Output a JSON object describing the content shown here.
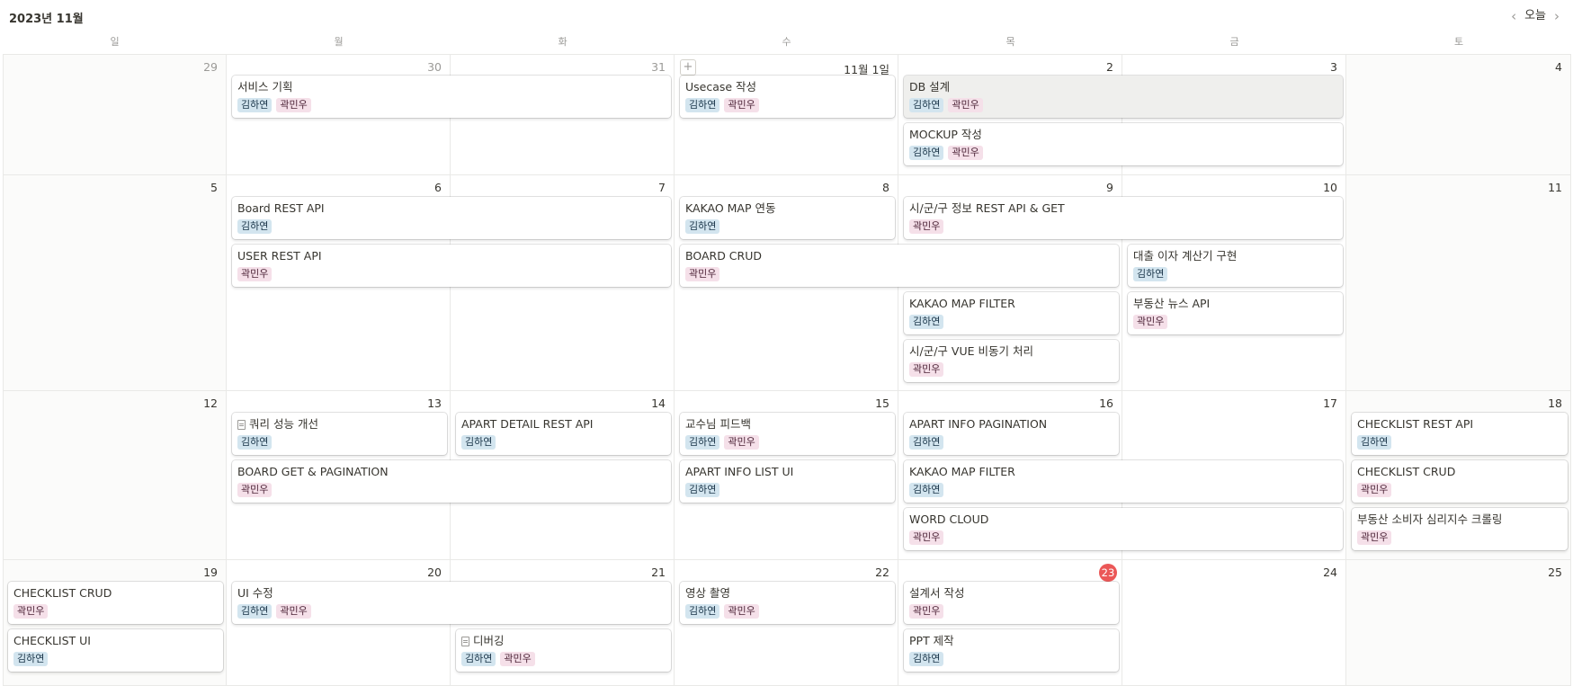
{
  "header": {
    "title": "2023년 11월",
    "today_label": "오늘",
    "prev_icon": "chevron-left-icon",
    "next_icon": "chevron-right-icon"
  },
  "weekdays": [
    "일",
    "월",
    "화",
    "수",
    "목",
    "금",
    "토"
  ],
  "today_date": "23",
  "add_button_icon": "plus-icon",
  "colors": {
    "tag_blue": "#d3e5ef",
    "tag_pink": "#f5e0e9",
    "today": "#eb5757"
  },
  "tag_names": {
    "kim": "김하연",
    "kwak": "곽민우"
  },
  "weeks": [
    {
      "days": [
        {
          "label": "29",
          "muted": true
        },
        {
          "label": "30",
          "muted": true
        },
        {
          "label": "31",
          "muted": true
        },
        {
          "label": "11월 1일",
          "plus": true
        },
        {
          "label": "2"
        },
        {
          "label": "3"
        },
        {
          "label": "4"
        }
      ],
      "events": [
        {
          "title": "서비스 기획",
          "col": 1,
          "span": 2,
          "lane": 0,
          "tags": [
            "kim",
            "kwak"
          ]
        },
        {
          "title": "Usecase 작성",
          "col": 3,
          "span": 1,
          "lane": 0,
          "tags": [
            "kim",
            "kwak"
          ]
        },
        {
          "title": "DB 설계",
          "col": 4,
          "span": 2,
          "lane": 0,
          "tags": [
            "kim",
            "kwak"
          ],
          "selected": true
        },
        {
          "title": "MOCKUP 작성",
          "col": 4,
          "span": 2,
          "lane": 1,
          "tags": [
            "kim",
            "kwak"
          ]
        }
      ]
    },
    {
      "days": [
        {
          "label": "5"
        },
        {
          "label": "6"
        },
        {
          "label": "7"
        },
        {
          "label": "8"
        },
        {
          "label": "9"
        },
        {
          "label": "10"
        },
        {
          "label": "11"
        }
      ],
      "events": [
        {
          "title": "Board REST API",
          "col": 1,
          "span": 2,
          "lane": 0,
          "tags": [
            "kim"
          ]
        },
        {
          "title": "KAKAO MAP 연동",
          "col": 3,
          "span": 1,
          "lane": 0,
          "tags": [
            "kim"
          ]
        },
        {
          "title": "시/군/구 정보 REST API & GET",
          "col": 4,
          "span": 2,
          "lane": 0,
          "tags": [
            "kwak"
          ]
        },
        {
          "title": "USER REST API",
          "col": 1,
          "span": 2,
          "lane": 1,
          "tags": [
            "kwak"
          ]
        },
        {
          "title": "BOARD CRUD",
          "col": 3,
          "span": 2,
          "lane": 1,
          "tags": [
            "kwak"
          ]
        },
        {
          "title": "대출 이자 계산기 구현",
          "col": 5,
          "span": 1,
          "lane": 1,
          "tags": [
            "kim"
          ]
        },
        {
          "title": "KAKAO MAP FILTER",
          "col": 4,
          "span": 1,
          "lane": 2,
          "tags": [
            "kim"
          ]
        },
        {
          "title": "부동산 뉴스 API",
          "col": 5,
          "span": 1,
          "lane": 2,
          "tags": [
            "kwak"
          ]
        },
        {
          "title": "시/군/구 VUE 비동기 처리",
          "col": 4,
          "span": 1,
          "lane": 3,
          "tags": [
            "kwak"
          ]
        }
      ]
    },
    {
      "days": [
        {
          "label": "12"
        },
        {
          "label": "13"
        },
        {
          "label": "14"
        },
        {
          "label": "15"
        },
        {
          "label": "16"
        },
        {
          "label": "17"
        },
        {
          "label": "18"
        }
      ],
      "events": [
        {
          "title": "쿼리 성능 개선",
          "col": 1,
          "span": 1,
          "lane": 0,
          "tags": [
            "kim"
          ],
          "doc": true
        },
        {
          "title": "APART DETAIL REST API",
          "col": 2,
          "span": 1,
          "lane": 0,
          "tags": [
            "kim"
          ]
        },
        {
          "title": "교수님 피드백",
          "col": 3,
          "span": 1,
          "lane": 0,
          "tags": [
            "kim",
            "kwak"
          ]
        },
        {
          "title": "APART INFO PAGINATION",
          "col": 4,
          "span": 1,
          "lane": 0,
          "tags": [
            "kim"
          ]
        },
        {
          "title": "CHECKLIST REST API",
          "col": 6,
          "span": 1,
          "lane": 0,
          "tags": [
            "kim"
          ]
        },
        {
          "title": "BOARD GET & PAGINATION",
          "col": 1,
          "span": 2,
          "lane": 1,
          "tags": [
            "kwak"
          ]
        },
        {
          "title": "APART INFO LIST UI",
          "col": 3,
          "span": 1,
          "lane": 1,
          "tags": [
            "kim"
          ]
        },
        {
          "title": "KAKAO MAP FILTER",
          "col": 4,
          "span": 2,
          "lane": 1,
          "tags": [
            "kim"
          ]
        },
        {
          "title": "CHECKLIST CRUD",
          "col": 6,
          "span": 1,
          "lane": 1,
          "tags": [
            "kwak"
          ]
        },
        {
          "title": "WORD CLOUD",
          "col": 4,
          "span": 2,
          "lane": 2,
          "tags": [
            "kwak"
          ]
        },
        {
          "title": "부동산 소비자 심리지수 크롤링",
          "col": 6,
          "span": 1,
          "lane": 2,
          "tags": [
            "kwak"
          ]
        }
      ]
    },
    {
      "days": [
        {
          "label": "19"
        },
        {
          "label": "20"
        },
        {
          "label": "21"
        },
        {
          "label": "22"
        },
        {
          "label": "23",
          "today": true
        },
        {
          "label": "24"
        },
        {
          "label": "25"
        }
      ],
      "events": [
        {
          "title": "CHECKLIST CRUD",
          "col": 0,
          "span": 1,
          "lane": 0,
          "tags": [
            "kwak"
          ]
        },
        {
          "title": "UI 수정",
          "col": 1,
          "span": 2,
          "lane": 0,
          "tags": [
            "kim",
            "kwak"
          ]
        },
        {
          "title": "영상 촬영",
          "col": 3,
          "span": 1,
          "lane": 0,
          "tags": [
            "kim",
            "kwak"
          ]
        },
        {
          "title": "설계서 작성",
          "col": 4,
          "span": 1,
          "lane": 0,
          "tags": [
            "kwak"
          ]
        },
        {
          "title": "CHECKLIST UI",
          "col": 0,
          "span": 1,
          "lane": 1,
          "tags": [
            "kim"
          ]
        },
        {
          "title": "디버깅",
          "col": 2,
          "span": 1,
          "lane": 1,
          "tags": [
            "kim",
            "kwak"
          ],
          "doc": true
        },
        {
          "title": "PPT 제작",
          "col": 4,
          "span": 1,
          "lane": 1,
          "tags": [
            "kim"
          ]
        }
      ]
    }
  ]
}
